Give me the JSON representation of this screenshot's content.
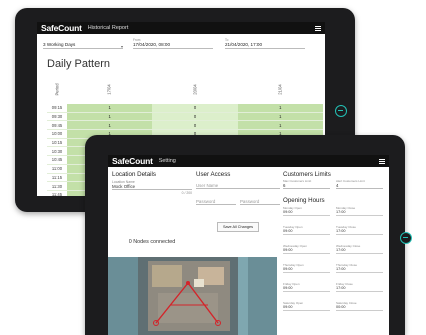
{
  "back_screen": {
    "brand": "SafeCount",
    "title": "Historical Report",
    "filter_period": "3 Working Days",
    "from_label": "From",
    "from_value": "17/04/2020, 08:00",
    "to_label": "To",
    "to_value": "21/04/2020, 17:00",
    "section_title": "Daily Pattern",
    "period_header": "Period",
    "columns": [
      "17/04",
      "20/04",
      "21/04"
    ],
    "rows": [
      {
        "period": "09:15",
        "values": [
          "1",
          "0",
          "1"
        ]
      },
      {
        "period": "09:30",
        "values": [
          "1",
          "0",
          "1"
        ]
      },
      {
        "period": "09:45",
        "values": [
          "1",
          "0",
          "1"
        ]
      },
      {
        "period": "10:00",
        "values": [
          "1",
          "0",
          "1"
        ]
      },
      {
        "period": "10:15",
        "values": [
          "1",
          "0",
          "1"
        ]
      },
      {
        "period": "10:30",
        "values": [
          "",
          "",
          ""
        ]
      },
      {
        "period": "10:45",
        "values": [
          "",
          "",
          ""
        ]
      },
      {
        "period": "11:00",
        "values": [
          "",
          "",
          ""
        ]
      },
      {
        "period": "11:15",
        "values": [
          "",
          "",
          ""
        ]
      },
      {
        "period": "11:30",
        "values": [
          "",
          "",
          ""
        ]
      },
      {
        "period": "11:45",
        "values": [
          "",
          "",
          ""
        ]
      },
      {
        "period": "12:00",
        "values": [
          "",
          "",
          ""
        ]
      }
    ]
  },
  "front_screen": {
    "brand": "SafeCount",
    "title": "Setting",
    "location": {
      "title": "Location Details",
      "name_label": "Location Name",
      "name_value": "Mock Office",
      "counter": "0 / 200"
    },
    "nodes_text": "0 Nodes connected",
    "user_access": {
      "title": "User Access",
      "user_name_placeholder": "User Name",
      "password_placeholder": "Password",
      "confirm_placeholder": "Password",
      "save_label": "Save All Changes"
    },
    "customer_limits": {
      "title": "Customers Limits",
      "max_label": "Max Customers Limit",
      "max_value": "6",
      "alert_label": "Alert Customers Limit",
      "alert_value": "4"
    },
    "opening_hours": {
      "title": "Opening Hours",
      "days": [
        {
          "open_label": "Monday Open",
          "open": "09:00",
          "close_label": "Monday Close",
          "close": "17:00"
        },
        {
          "open_label": "Tuesday Open",
          "open": "09:00",
          "close_label": "Tuesday Close",
          "close": "17:00"
        },
        {
          "open_label": "Wednesday Open",
          "open": "09:00",
          "close_label": "Wednesday Close",
          "close": "17:00"
        },
        {
          "open_label": "Thursday Open",
          "open": "09:00",
          "close_label": "Thursday Close",
          "close": "17:00"
        },
        {
          "open_label": "Friday Open",
          "open": "09:00",
          "close_label": "Friday Close",
          "close": "17:00"
        },
        {
          "open_label": "Saturday Open",
          "open": "09:00",
          "close_label": "Saturday Close",
          "close": "00:00"
        }
      ]
    }
  },
  "colors": {
    "accent": "#23c0b5",
    "cell_green": "#c3e0a8",
    "header_bg": "#111111",
    "bezel": "#1c1c1e"
  },
  "icons": [
    "menu-icon",
    "home-button-icon",
    "dropdown-caret-icon"
  ]
}
